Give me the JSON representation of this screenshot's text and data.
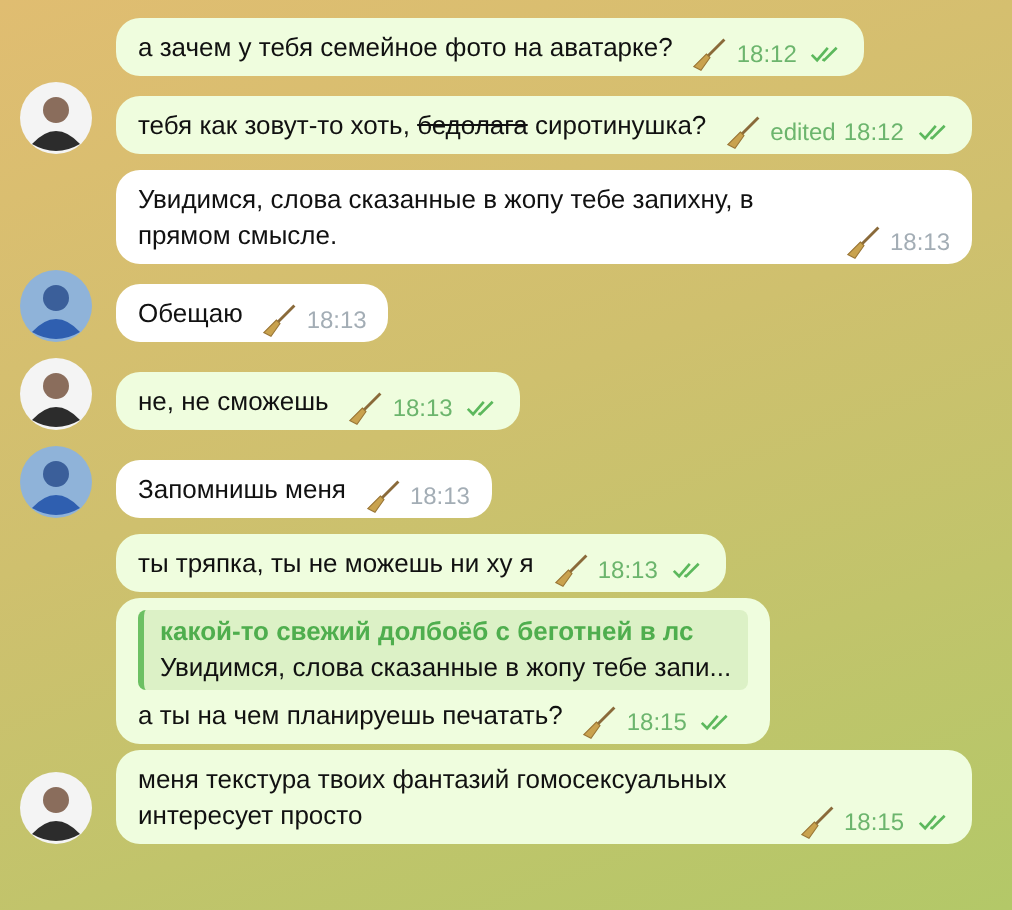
{
  "messages": [
    {
      "kind": "out",
      "avatar": false,
      "parts": [
        {
          "text": "а зачем у тебя семейное фото на аватарке?",
          "struck": false
        }
      ],
      "time": "18:12",
      "read": true
    },
    {
      "kind": "out",
      "avatar": true,
      "parts": [
        {
          "text": "тебя как зовут-то хоть, ",
          "struck": false
        },
        {
          "text": "бедолага",
          "struck": true
        },
        {
          "text": " сиротинушка?",
          "struck": false
        }
      ],
      "edited": "edited",
      "time": "18:12",
      "read": true
    },
    {
      "kind": "in",
      "avatar": false,
      "parts": [
        {
          "text": "Увидимся, слова сказанные в жопу тебе запихну, в прямом смысле.",
          "struck": false
        }
      ],
      "time": "18:13",
      "read": false
    },
    {
      "kind": "in",
      "avatar": true,
      "parts": [
        {
          "text": "Обещаю",
          "struck": false
        }
      ],
      "time": "18:13",
      "read": false
    },
    {
      "kind": "out",
      "avatar": true,
      "parts": [
        {
          "text": "не, не сможешь",
          "struck": false
        }
      ],
      "time": "18:13",
      "read": true
    },
    {
      "kind": "in",
      "avatar": true,
      "parts": [
        {
          "text": "Запомнишь меня",
          "struck": false
        }
      ],
      "time": "18:13",
      "read": false
    },
    {
      "kind": "out",
      "avatar": false,
      "parts": [
        {
          "text": "ты тряпка, ты не можешь ни ху я",
          "struck": false
        }
      ],
      "time": "18:13",
      "read": true
    },
    {
      "kind": "out",
      "avatar": false,
      "reply": {
        "name": "какой-то свежий долбоёб с беготней в лс",
        "text": "Увидимся, слова сказанные в жопу тебе запи..."
      },
      "parts": [
        {
          "text": "а ты на чем планируешь печатать?",
          "struck": false
        }
      ],
      "time": "18:15",
      "read": true
    },
    {
      "kind": "out",
      "avatar": true,
      "parts": [
        {
          "text": "меня текстура твоих фантазий гомосексуальных интересует просто",
          "struck": false
        }
      ],
      "time": "18:15",
      "read": true
    }
  ]
}
